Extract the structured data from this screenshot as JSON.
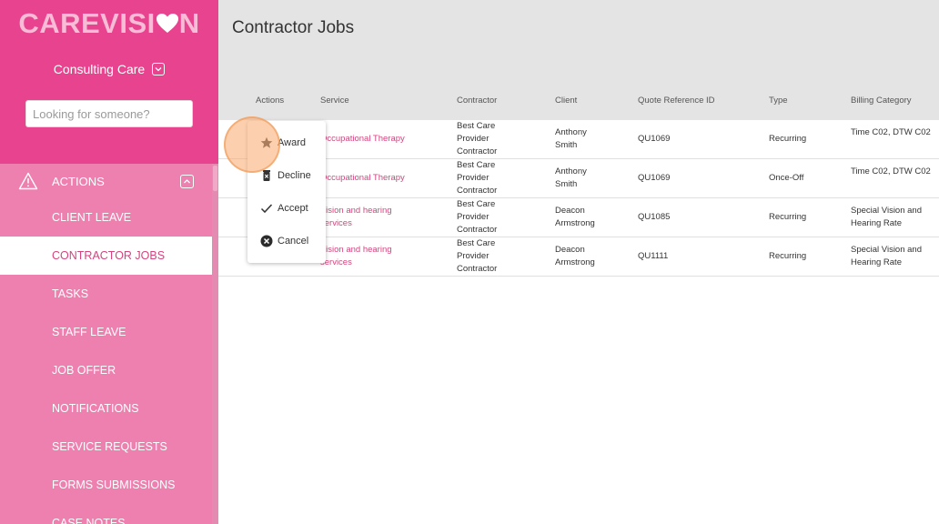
{
  "brand": {
    "logo_left": "CAREVISI",
    "logo_right": "N",
    "org": "Consulting Care"
  },
  "search": {
    "placeholder": "Looking for someone?"
  },
  "nav": {
    "section": "ACTIONS",
    "items": [
      "CLIENT LEAVE",
      "CONTRACTOR JOBS",
      "TASKS",
      "STAFF LEAVE",
      "JOB OFFER",
      "NOTIFICATIONS",
      "SERVICE REQUESTS",
      "FORMS SUBMISSIONS",
      "CASE NOTES"
    ]
  },
  "page": {
    "title": "Contractor Jobs"
  },
  "table": {
    "headers": [
      "Actions",
      "Service",
      "Contractor",
      "Client",
      "Quote Reference ID",
      "Type",
      "Billing Category"
    ],
    "rows": [
      {
        "service": "Occupational Therapy",
        "contractor": "Best Care Provider Contractor",
        "client": "Anthony Smith",
        "ref": "QU1069",
        "type": "Recurring",
        "billing": "Time C02, DTW C02"
      },
      {
        "service": "Occupational Therapy",
        "contractor": "Best Care Provider Contractor",
        "client": "Anthony Smith",
        "ref": "QU1069",
        "type": "Once-Off",
        "billing": "Time C02, DTW C02"
      },
      {
        "service": "Vision and hearing services",
        "contractor": "Best Care Provider Contractor",
        "client": "Deacon Armstrong",
        "ref": "QU1085",
        "type": "Recurring",
        "billing": "Special Vision and Hearing Rate"
      },
      {
        "service": "Vision and hearing services",
        "contractor": "Best Care Provider Contractor",
        "client": "Deacon Armstrong",
        "ref": "QU1111",
        "type": "Recurring",
        "billing": "Special Vision and Hearing Rate"
      }
    ]
  },
  "menu": {
    "award": "Award",
    "decline": "Decline",
    "accept": "Accept",
    "cancel": "Cancel"
  },
  "colors": {
    "brand_pink": "#e8438e",
    "nav_pink": "#ee80b0",
    "link_pink": "#d4447f",
    "header_grey": "#e4e4e4"
  }
}
